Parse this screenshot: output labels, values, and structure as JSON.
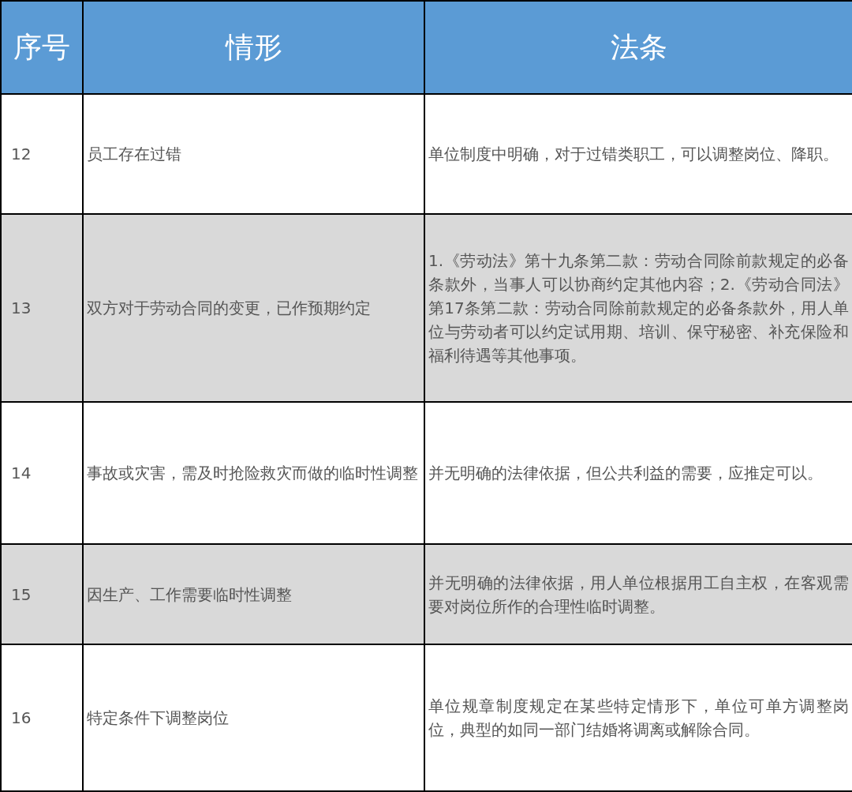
{
  "table": {
    "columns": [
      "序号",
      "情形",
      "法条"
    ],
    "rows": [
      {
        "number": "12",
        "situation": "员工存在过错",
        "law": "单位制度中明确，对于过错类职工，可以调整岗位、降职。"
      },
      {
        "number": "13",
        "situation": "双方对于劳动合同的变更，已作预期约定",
        "law": "1.《劳动法》第十九条第二款：劳动合同除前款规定的必备条款外，当事人可以协商约定其他内容；2.《劳动合同法》第17条第二款：劳动合同除前款规定的必备条款外，用人单位与劳动者可以约定试用期、培训、保守秘密、补充保险和福利待遇等其他事项。"
      },
      {
        "number": "14",
        "situation": "事故或灾害，需及时抢险救灾而做的临时性调整",
        "law": "并无明确的法律依据，但公共利益的需要，应推定可以。"
      },
      {
        "number": "15",
        "situation": "因生产、工作需要临时性调整",
        "law": "并无明确的法律依据，用人单位根据用工自主权，在客观需要对岗位所作的合理性临时调整。"
      },
      {
        "number": "16",
        "situation": "特定条件下调整岗位",
        "law": "单位规章制度规定在某些特定情形下，单位可单方调整岗位，典型的如同一部门结婚将调离或解除合同。"
      }
    ]
  }
}
